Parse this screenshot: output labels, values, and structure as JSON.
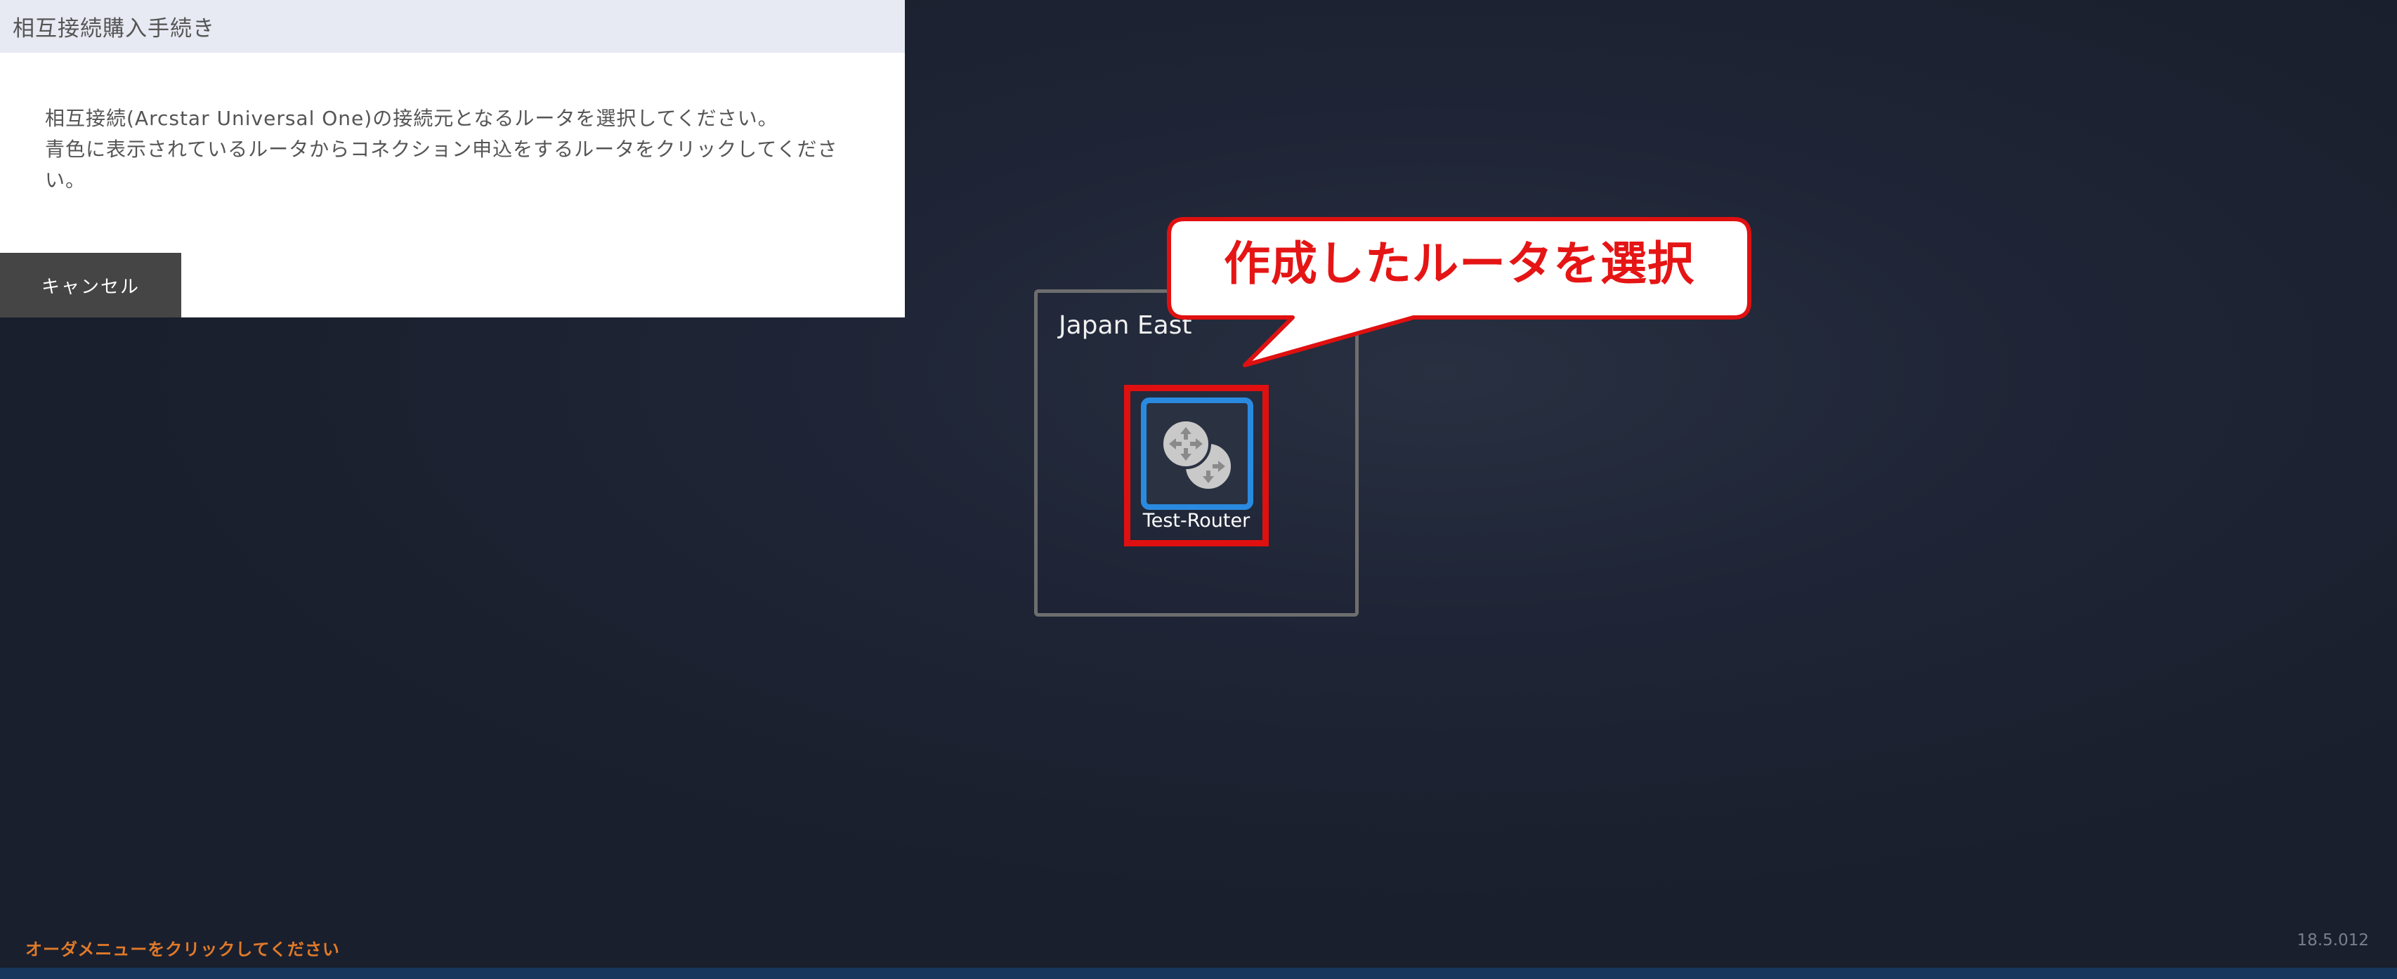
{
  "dialog": {
    "title": "相互接続購入手続き",
    "instruction_line1": "相互接続(Arcstar Universal One)の接続元となるルータを選択してください。",
    "instruction_line2": "青色に表示されているルータからコネクション申込をするルータをクリックしてください。",
    "cancel_label": "キャンセル"
  },
  "region": {
    "label": "Japan East"
  },
  "router": {
    "name": "Test-Router",
    "icon": "router-icon",
    "highlight_color": "#e01010",
    "tile_border_color": "#2a8ae0"
  },
  "callout": {
    "text": "作成したルータを選択",
    "text_color": "#e51515"
  },
  "footer": {
    "hint": "オーダメニューをクリックしてください",
    "hint_color": "#e07a2a",
    "version": "18.5.012"
  },
  "colors": {
    "bottom_bar": "#17385c"
  }
}
